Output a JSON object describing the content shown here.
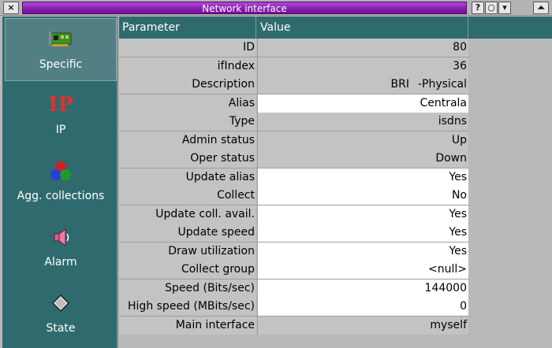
{
  "window": {
    "title": "Network interface",
    "buttons": {
      "close": "×",
      "help": "?",
      "shade": "○",
      "minimize": "▾",
      "maximize": "⏶"
    }
  },
  "sidebar": {
    "items": [
      {
        "label": "Specific",
        "icon": "network-card-icon",
        "selected": true
      },
      {
        "label": "IP",
        "icon": "ip-icon",
        "icon_text": "IP",
        "selected": false
      },
      {
        "label": "Agg. collections",
        "icon": "aggregate-circles-icon",
        "selected": false
      },
      {
        "label": "Alarm",
        "icon": "speaker-icon",
        "selected": false
      },
      {
        "label": "State",
        "icon": "diamond-icon",
        "selected": false
      }
    ]
  },
  "table": {
    "headers": {
      "parameter": "Parameter",
      "value": "Value"
    },
    "rows": [
      {
        "param": "ID",
        "value": "80",
        "editable": false
      },
      {
        "param": "ifIndex",
        "value": "36",
        "editable": false
      },
      {
        "param": "Description",
        "value_a": "BRI",
        "value_b": "-Physical",
        "editable": false
      },
      {
        "param": "Alias",
        "value": "Centrala",
        "editable": true
      },
      {
        "param": "Type",
        "value": "isdns",
        "editable": false
      },
      {
        "param": "Admin status",
        "value": "Up",
        "editable": false
      },
      {
        "param": "Oper status",
        "value": "Down",
        "editable": false
      },
      {
        "param": "Update alias",
        "value": "Yes",
        "editable": true
      },
      {
        "param": "Collect",
        "value": "No",
        "editable": true
      },
      {
        "param": "Update coll. avail.",
        "value": "Yes",
        "editable": true
      },
      {
        "param": "Update speed",
        "value": "Yes",
        "editable": true
      },
      {
        "param": "Draw utilization",
        "value": "Yes",
        "editable": true
      },
      {
        "param": "Collect group",
        "value": "<null>",
        "editable": true
      },
      {
        "param": "Speed (Bits/sec)",
        "value": "144000",
        "editable": true
      },
      {
        "param": "High speed (MBits/sec)",
        "value": "0",
        "editable": true
      },
      {
        "param": "Main interface",
        "value": "myself",
        "editable": false
      }
    ]
  },
  "colors": {
    "title_accent": "#8b1fb2",
    "sidebar_bg": "#2f6b6e",
    "header_bg": "#2f6b6e",
    "readonly_cell": "#c3c3c3",
    "editable_cell": "#ffffff"
  }
}
